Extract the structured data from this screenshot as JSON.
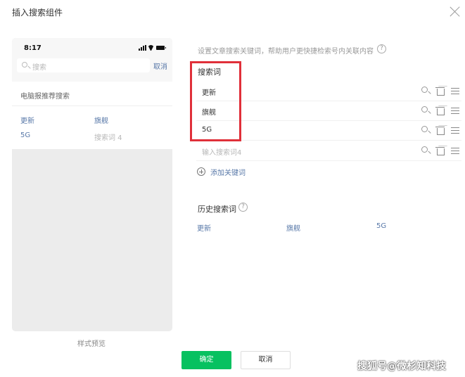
{
  "dialog": {
    "title": "插入搜索组件"
  },
  "preview": {
    "status_time": "8:17",
    "search_placeholder": "搜索",
    "cancel_label": "取消",
    "recommend_title": "电脑报推荐搜索",
    "items": [
      "更新",
      "旗舰",
      "5G",
      "搜索词 4"
    ],
    "label": "样式预览"
  },
  "settings": {
    "hint": "设置文章搜索关键词，帮助用户更快捷检索号内关联内容",
    "keywords_label": "搜索词",
    "keywords": [
      "更新",
      "旗舰",
      "5G"
    ],
    "new_keyword_placeholder": "输入搜索词4",
    "add_keyword_label": "添加关键词",
    "history_label": "历史搜索词",
    "history": [
      "更新",
      "旗舰",
      "5G"
    ]
  },
  "footer": {
    "confirm_label": "确定",
    "cancel_label": "取消"
  },
  "watermark": "搜狐号@微杉知科技",
  "colors": {
    "accent": "#07c160",
    "link": "#5878a8",
    "highlight": "#e0303a",
    "phone_bg": "#ececec"
  },
  "icons": {
    "close": "close-icon",
    "help": "help-icon",
    "search": "search-icon",
    "delete": "trash-icon",
    "drag": "drag-handle-icon",
    "add": "plus-circle-icon"
  }
}
